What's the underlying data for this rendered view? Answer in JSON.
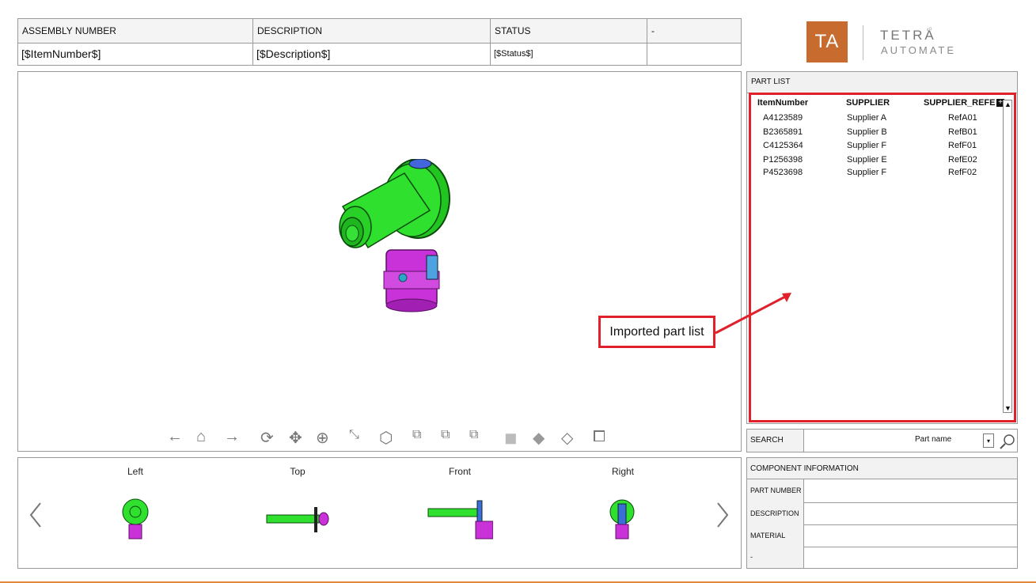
{
  "header": {
    "labels": [
      "ASSEMBLY NUMBER",
      "DESCRIPTION",
      "STATUS",
      "-"
    ],
    "values": [
      "[$ItemNumber$]",
      "[$Description$]",
      "[$Status$]",
      ""
    ]
  },
  "logo": {
    "mark": "TA",
    "name": "TETRA",
    "tagline": "AUTOMATE"
  },
  "part_list": {
    "title": "PART LIST",
    "columns": [
      "ItemNumber",
      "SUPPLIER",
      "SUPPLIER_REFE"
    ],
    "rows": [
      [
        "A4123589",
        "Supplier A",
        "RefA01"
      ],
      [
        "B2365891",
        "Supplier B",
        "RefB01"
      ],
      [
        "C4125364",
        "Supplier F",
        "RefF01"
      ],
      [
        "P1256398",
        "Supplier E",
        "RefE02"
      ],
      [
        "P4523698",
        "Supplier F",
        "RefF02"
      ]
    ]
  },
  "annotation": {
    "text": "Imported part list",
    "color": "#e0202a"
  },
  "search": {
    "label": "SEARCH",
    "selected": "Part name"
  },
  "component_info": {
    "title": "COMPONENT INFORMATION",
    "fields": [
      "PART NUMBER",
      "DESCRIPTION",
      "MATERIAL",
      "-"
    ]
  },
  "thumbnails": {
    "labels": [
      "Left",
      "Top",
      "Front",
      "Right"
    ]
  },
  "toolbar_icons": [
    "arrow-left-icon",
    "home-icon",
    "arrow-right-icon",
    "rotate-icon",
    "pan-icon",
    "zoom-window-icon",
    "fit-all-icon",
    "iso-view-icon",
    "view-cube-1-icon",
    "view-cube-2-icon",
    "view-cube-3-icon",
    "shaded-icon",
    "shaded-edges-icon",
    "wireframe-icon",
    "fullscreen-icon"
  ],
  "colors": {
    "accent": "#c76b2e",
    "highlight": "#e0202a",
    "part_green": "#22d322",
    "part_magenta": "#c832d8"
  }
}
